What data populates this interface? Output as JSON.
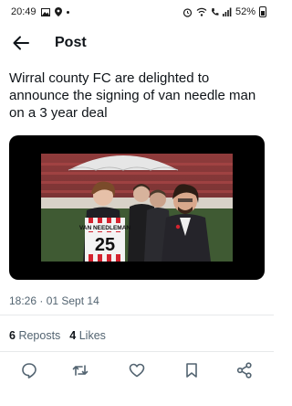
{
  "status_bar": {
    "time": "20:49",
    "battery": "52%"
  },
  "header": {
    "title": "Post"
  },
  "tweet": {
    "text": "Wirral county FC are delighted to announce the signing of van needle man on a 3 year deal",
    "media": {
      "shirt_name": "VAN NEEDLEMAN",
      "shirt_number": "25"
    },
    "timestamp": "18:26 · 01 Sept 14",
    "reposts": {
      "count": "6",
      "label": "Reposts"
    },
    "likes": {
      "count": "4",
      "label": "Likes"
    }
  },
  "icons": {
    "back": "arrow-left-icon",
    "reply": "comment-icon",
    "repost": "repost-icon",
    "like": "heart-icon",
    "bookmark": "bookmark-icon",
    "share": "share-icon"
  },
  "colors": {
    "text": "#0f1419",
    "secondary": "#536471",
    "divider": "#e7e9ea"
  }
}
